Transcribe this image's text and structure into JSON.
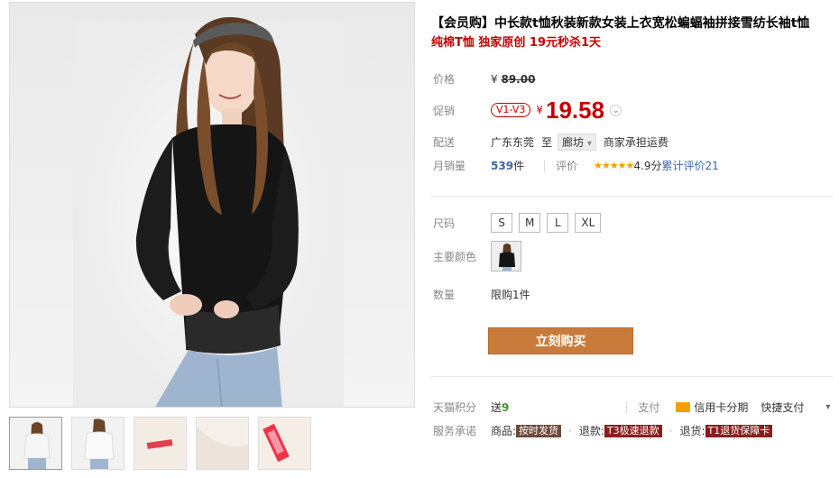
{
  "product": {
    "title": "【会员购】中长款t恤秋装新款女装上衣宽松蝙蝠袖拼接雪纺长袖t恤",
    "subtitle": "纯棉T恤 独家原创 19元秒杀1天"
  },
  "price": {
    "label": "价格",
    "currency": "¥",
    "original": "89.00"
  },
  "promo": {
    "label": "促销",
    "badge": "V1-V3",
    "currency": "¥",
    "price": "19.58",
    "arrow": "⌄"
  },
  "shipping": {
    "label": "配送",
    "origin": "广东东莞",
    "to": "至",
    "destination": "廊坊",
    "dest_arrow": "▾",
    "note": "商家承担运费"
  },
  "sales": {
    "label": "月销量",
    "count": "539",
    "unit": "件",
    "review_label": "评价",
    "stars": "★★★★★",
    "score": "4.9分",
    "review_link": "累计评价21"
  },
  "size": {
    "label": "尺码",
    "options": [
      "S",
      "M",
      "L",
      "XL"
    ]
  },
  "color": {
    "label": "主要颜色"
  },
  "quantity": {
    "label": "数量",
    "limit": "限购1件"
  },
  "buy_button": "立刻购买",
  "tmall_points": {
    "label": "天猫积分",
    "text": "送",
    "value": "9"
  },
  "payment": {
    "label": "支付",
    "credit": "信用卡分期",
    "quick": "快捷支付",
    "arrow": "▾"
  },
  "service": {
    "label": "服务承诺",
    "goods_label": "商品:",
    "goods_tag": "按时发货",
    "refund_label": "退款:",
    "refund_tag": "T3极速退款",
    "return_label": "退货:",
    "return_tag": "T1退货保障卡"
  },
  "colors": {
    "price_red": "#c40000",
    "buy_orange": "#c97b3c",
    "link_blue": "#3c67a8",
    "star_gold": "#f0a000"
  }
}
